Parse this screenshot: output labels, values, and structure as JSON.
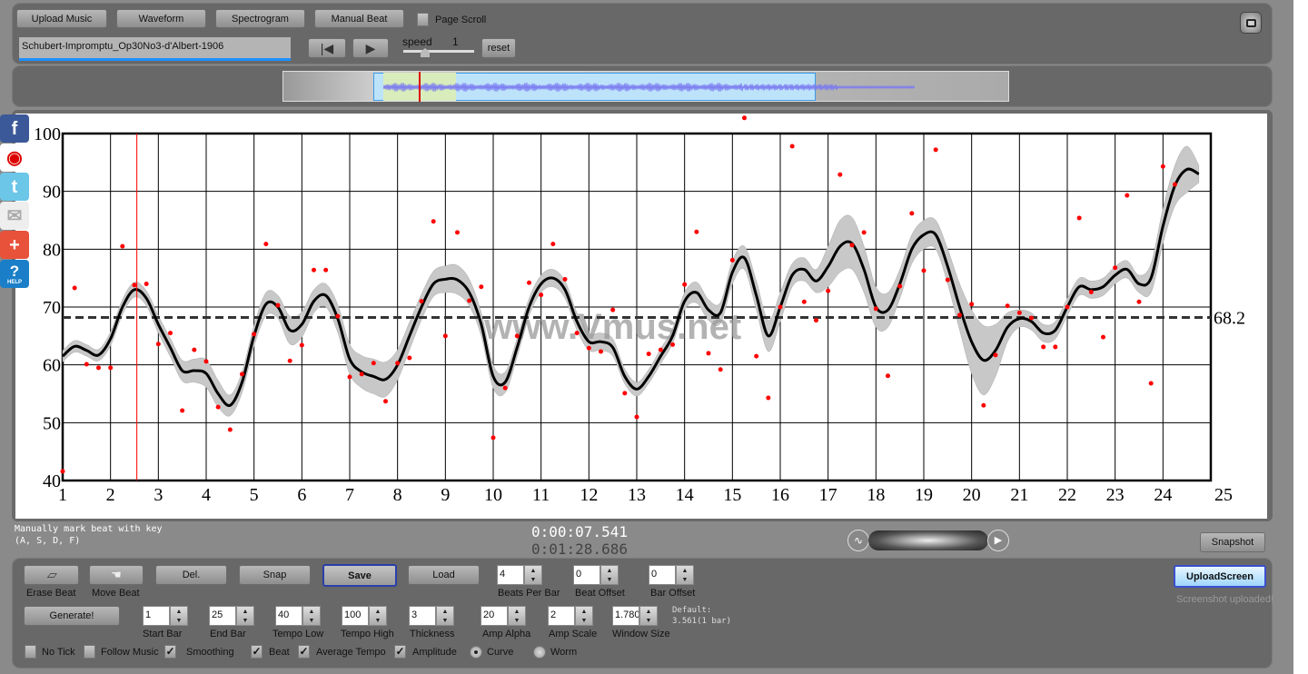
{
  "toolbar": {
    "upload_music": "Upload Music",
    "waveform": "Waveform",
    "spectrogram": "Spectrogram",
    "manual_beat": "Manual Beat",
    "page_scroll": "Page Scroll",
    "page_scroll_checked": false,
    "file_name": "Schubert-Impromptu_Op30No3-d'Albert-1906",
    "speed_label": "speed",
    "speed_value": "1",
    "reset": "reset"
  },
  "social": [
    "facebook-icon",
    "weibo-icon",
    "twitter-icon",
    "email-icon",
    "add-icon",
    "help-icon"
  ],
  "social_help_text": "HELP",
  "watermark": "www.Vmus.net",
  "info": {
    "line1": "Manually mark beat with key",
    "line2": "(A, S, D, F)",
    "time_current": "0:00:07.541",
    "time_total": "0:01:28.686"
  },
  "snapshot": "Snapshot",
  "upload_screen": "UploadScreen",
  "upload_status": "Screenshot uploaded!",
  "controls": {
    "erase_beat": "Erase Beat",
    "move_beat": "Move Beat",
    "del": "Del.",
    "snap": "Snap",
    "save": "Save",
    "load": "Load",
    "beats_per_bar": {
      "label": "Beats Per Bar",
      "value": "4"
    },
    "beat_offset": {
      "label": "Beat Offset",
      "value": "0"
    },
    "bar_offset": {
      "label": "Bar Offset",
      "value": "0"
    },
    "generate": "Generate!",
    "start_bar": {
      "label": "Start Bar",
      "value": "1"
    },
    "end_bar": {
      "label": "End Bar",
      "value": "25"
    },
    "tempo_low": {
      "label": "Tempo Low",
      "value": "40"
    },
    "tempo_high": {
      "label": "Tempo High",
      "value": "100"
    },
    "thickness": {
      "label": "Thickness",
      "value": "3"
    },
    "amp_alpha": {
      "label": "Amp Alpha",
      "value": "20"
    },
    "amp_scale": {
      "label": "Amp Scale",
      "value": "2"
    },
    "window_size": {
      "label": "Window Size",
      "value": "1.78048"
    },
    "default_line1": "Default:",
    "default_line2": "3.561(1 bar)",
    "checkboxes": [
      {
        "label": "No Tick",
        "checked": false
      },
      {
        "label": "Follow Music",
        "checked": false
      },
      {
        "label": "Smoothing",
        "checked": true
      },
      {
        "label": "Beat",
        "checked": true
      },
      {
        "label": "Average Tempo",
        "checked": true
      },
      {
        "label": "Amplitude",
        "checked": true
      }
    ],
    "radios": [
      {
        "label": "Curve",
        "selected": true
      },
      {
        "label": "Worm",
        "selected": false
      }
    ]
  },
  "chart_data": {
    "type": "scatter",
    "xlim": [
      1,
      25
    ],
    "ylim": [
      40,
      100
    ],
    "xticks": [
      1,
      2,
      3,
      4,
      5,
      6,
      7,
      8,
      9,
      10,
      11,
      12,
      13,
      14,
      15,
      16,
      17,
      18,
      19,
      20,
      21,
      22,
      23,
      24,
      25
    ],
    "yticks": [
      40,
      50,
      60,
      70,
      80,
      90,
      100
    ],
    "grid": true,
    "average_tempo": 68.2,
    "average_label": "68.2",
    "cursor_x": 2.55,
    "colors": {
      "beats": "#ff0000",
      "curve": "#000000",
      "band": "#c8c8c8",
      "cursor": "#ff0000",
      "average": "#333333"
    },
    "beats_x_start": 1,
    "beats_x_step": 0.25,
    "beats": [
      41.6,
      73.3,
      60.1,
      59.5,
      59.5,
      80.5,
      73.8,
      74.0,
      63.6,
      65.5,
      52.1,
      62.6,
      60.6,
      52.7,
      48.8,
      58.4,
      65.3,
      80.9,
      70.3,
      60.7,
      63.4,
      76.4,
      76.4,
      68.4,
      57.9,
      58.4,
      60.3,
      53.7,
      60.3,
      61.2,
      71.0,
      84.8,
      65.0,
      82.9,
      71.1,
      73.5,
      47.4,
      56.0,
      65.0,
      74.2,
      72.1,
      80.9,
      74.8,
      65.5,
      62.9,
      62.3,
      69.5,
      55.1,
      51.0,
      61.9,
      62.6,
      63.5,
      73.9,
      83.0,
      62.0,
      59.2,
      78.1,
      102.7,
      61.5,
      54.3,
      70.0,
      97.8,
      70.9,
      67.7,
      72.8,
      92.9,
      80.7,
      82.9,
      69.7,
      58.1,
      73.6,
      86.2,
      76.3,
      97.2,
      74.7,
      68.6,
      70.5,
      53.0,
      61.7,
      70.2,
      69.0,
      68.1,
      63.1,
      63.1,
      70.0,
      85.4,
      72.6,
      64.8,
      76.8,
      89.3,
      70.9,
      56.8,
      94.3,
      91.2
    ],
    "smoothed_x_step": 0.25,
    "smoothed": [
      61.5,
      63.2,
      62.5,
      61.7,
      64.5,
      70,
      73,
      71.5,
      67,
      63,
      59,
      59,
      58.5,
      55,
      53,
      57,
      65,
      70.5,
      70,
      66,
      67,
      71,
      72,
      68,
      61,
      58.8,
      58,
      57.5,
      60,
      65,
      70,
      74,
      74.8,
      74.7,
      72.5,
      67,
      58,
      57,
      63,
      70,
      74,
      75,
      73,
      67.5,
      64,
      64,
      63,
      58,
      55.8,
      58,
      61.5,
      65,
      71,
      72.5,
      69.5,
      69,
      76,
      78.5,
      72,
      65,
      70,
      75.5,
      76.5,
      74.5,
      77,
      80.5,
      81,
      76.5,
      70,
      69.5,
      74,
      80,
      82.5,
      82.5,
      77,
      70,
      64,
      60.8,
      62.5,
      66.5,
      68,
      67.5,
      65.5,
      66,
      70,
      73.5,
      73,
      73.5,
      75.5,
      76.5,
      74,
      75,
      84,
      91,
      93.8,
      93
    ],
    "band_halfwidth": [
      1,
      1,
      1,
      1,
      1.2,
      1.3,
      1.3,
      1.3,
      1.5,
      1.6,
      1.8,
      2,
      2.4,
      2.3,
      1.8,
      1.8,
      1.8,
      2,
      2,
      2.4,
      2.2,
      2,
      2,
      2.4,
      2.6,
      2.8,
      3,
      3,
      2.6,
      2.4,
      2.2,
      2.2,
      2.3,
      2.5,
      2.3,
      2,
      2,
      1.8,
      1.6,
      1.5,
      1.5,
      1.5,
      1.5,
      1.5,
      1.5,
      1.5,
      1.5,
      1.3,
      1.2,
      1.2,
      1.3,
      1.3,
      1.5,
      1.8,
      1.8,
      1.8,
      2,
      2,
      2.5,
      2.7,
      2.5,
      2,
      2,
      2,
      3.5,
      4.5,
      4.5,
      4,
      3.5,
      3,
      2.5,
      2.5,
      2.5,
      2.5,
      3,
      4,
      5.5,
      6,
      4.5,
      2.5,
      1.5,
      1.5,
      1.5,
      1.5,
      1.5,
      1.5,
      1.5,
      1.5,
      1.5,
      1.5,
      1.5,
      2.5,
      3,
      3.5,
      4
    ]
  }
}
